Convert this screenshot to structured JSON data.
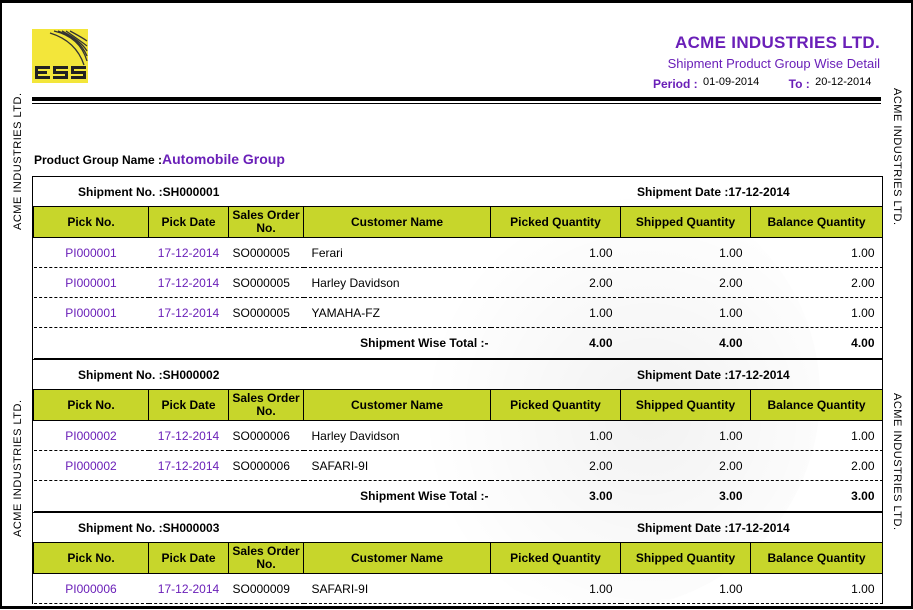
{
  "header": {
    "company": "ACME INDUSTRIES LTD.",
    "report_title": "Shipment Product Group Wise Detail",
    "period_label": "Period :",
    "period_from": "01-09-2014",
    "to_label": "To :",
    "period_to": "20-12-2014",
    "side_text": "ACME INDUSTRIES LTD.",
    "logo_text": "ESS"
  },
  "product_group": {
    "label": "Product Group Name :",
    "value": "Automobile Group"
  },
  "columns": [
    "Pick No.",
    "Pick Date",
    "Sales Order No.",
    "Customer Name",
    "Picked Quantity",
    "Shipped Quantity",
    "Balance Quantity"
  ],
  "total_label": "Shipment Wise Total :-",
  "shipments": [
    {
      "no_label": "Shipment No. :SH000001",
      "date_label": "Shipment Date :17-12-2014",
      "rows": [
        [
          "PI000001",
          "17-12-2014",
          "SO000005",
          "Ferari",
          "1.00",
          "1.00",
          "1.00"
        ],
        [
          "PI000001",
          "17-12-2014",
          "SO000005",
          "Harley Davidson",
          "2.00",
          "2.00",
          "2.00"
        ],
        [
          "PI000001",
          "17-12-2014",
          "SO000005",
          "YAMAHA-FZ",
          "1.00",
          "1.00",
          "1.00"
        ]
      ],
      "totals": [
        "4.00",
        "4.00",
        "4.00"
      ]
    },
    {
      "no_label": "Shipment No. :SH000002",
      "date_label": "Shipment Date :17-12-2014",
      "rows": [
        [
          "PI000002",
          "17-12-2014",
          "SO000006",
          "Harley Davidson",
          "1.00",
          "1.00",
          "1.00"
        ],
        [
          "PI000002",
          "17-12-2014",
          "SO000006",
          "SAFARI-9I",
          "2.00",
          "2.00",
          "2.00"
        ]
      ],
      "totals": [
        "3.00",
        "3.00",
        "3.00"
      ]
    },
    {
      "no_label": "Shipment No. :SH000003",
      "date_label": "Shipment Date :17-12-2014",
      "rows": [
        [
          "PI000006",
          "17-12-2014",
          "SO000009",
          "SAFARI-9I",
          "1.00",
          "1.00",
          "1.00"
        ]
      ],
      "totals": null
    }
  ]
}
